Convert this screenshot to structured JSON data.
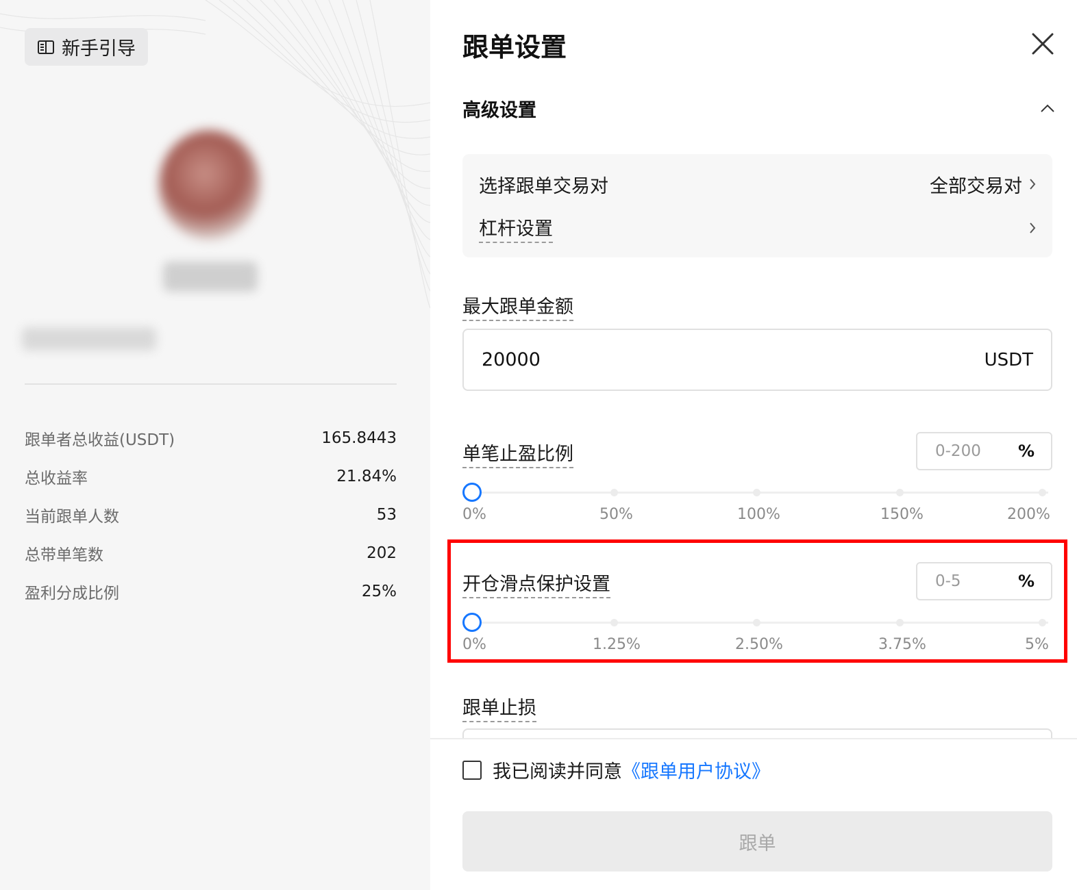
{
  "left_panel": {
    "guide_button": {
      "label": "新手引导",
      "icon": "book-icon"
    },
    "stats": [
      {
        "label": "跟单者总收益(USDT)",
        "value": "165.8443"
      },
      {
        "label": "总收益率",
        "value": "21.84%"
      },
      {
        "label": "当前跟单人数",
        "value": "53"
      },
      {
        "label": "总带单笔数",
        "value": "202"
      },
      {
        "label": "盈利分成比例",
        "value": "25%"
      }
    ]
  },
  "drawer": {
    "title": "跟单设置",
    "close_icon": "close-icon",
    "advanced": {
      "label": "高级设置",
      "icon": "chevron-up-icon"
    },
    "pair_select": {
      "label": "选择跟单交易对",
      "value": "全部交易对"
    },
    "leverage": {
      "label": "杠杆设置"
    },
    "max_amount": {
      "label": "最大跟单金额",
      "value": "20000",
      "unit": "USDT"
    },
    "take_profit": {
      "label": "单笔止盈比例",
      "placeholder": "0-200",
      "unit": "%",
      "slider_value": 0,
      "ticks": [
        "0%",
        "50%",
        "100%",
        "150%",
        "200%"
      ]
    },
    "slippage": {
      "label": "开仓滑点保护设置",
      "placeholder": "0-5",
      "unit": "%",
      "slider_value": 0,
      "ticks": [
        "0%",
        "1.25%",
        "2.50%",
        "3.75%",
        "5%"
      ]
    },
    "stop_loss": {
      "label": "跟单止损"
    },
    "agreement": {
      "text": "我已阅读并同意",
      "link": "《跟单用户协议》",
      "checked": false
    },
    "submit": {
      "label": "跟单"
    }
  },
  "colors": {
    "accent": "#1677ff",
    "highlight": "#ff0000",
    "left_bg": "#f6f6f6",
    "disabled_button": "#ebebeb"
  }
}
